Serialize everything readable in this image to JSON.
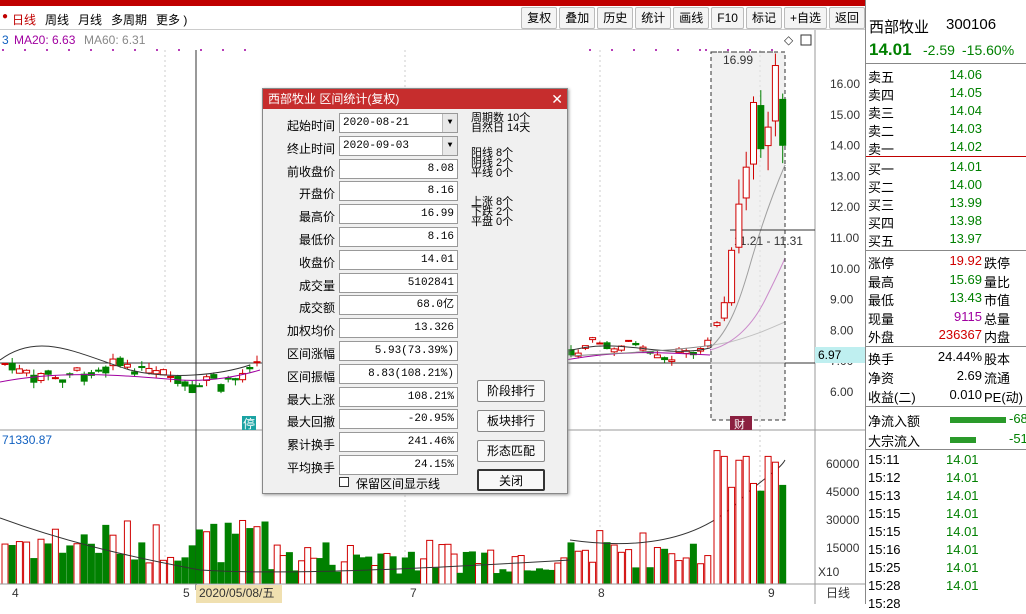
{
  "period_tabs": [
    "日线",
    "周线",
    "月线",
    "多周期",
    "更多 )"
  ],
  "toolbar": [
    "复权",
    "叠加",
    "历史",
    "统计",
    "画线",
    "F10",
    "标记",
    "+自选",
    "返回"
  ],
  "ma_legend": {
    "ma20": "MA20: 6.63",
    "ma60": "MA60: 6.31"
  },
  "price_axis": [
    "16.00",
    "15.00",
    "14.00",
    "13.00",
    "12.00",
    "11.00",
    "10.00",
    "9.00",
    "8.00",
    "7.00",
    "6.00"
  ],
  "vol_axis": [
    "60000",
    "45000",
    "30000",
    "15000",
    "X10"
  ],
  "date_axis": [
    "4",
    "5",
    "2020/05/08/五",
    "7",
    "8",
    "9",
    "日线"
  ],
  "price_marker": "6.97",
  "high_label": "16.99",
  "range_label": "11.21 - 11.31",
  "vol_label": "71330.87",
  "ting_mark": "停",
  "dialog": {
    "title": "西部牧业 区间统计(复权)",
    "fields": [
      {
        "label": "起始时间",
        "value": "2020-08-21",
        "type": "date"
      },
      {
        "label": "终止时间",
        "value": "2020-09-03",
        "type": "date"
      },
      {
        "label": "前收盘价",
        "value": "8.08"
      },
      {
        "label": "开盘价",
        "value": "8.16"
      },
      {
        "label": "最高价",
        "value": "16.99"
      },
      {
        "label": "最低价",
        "value": "8.16"
      },
      {
        "label": "收盘价",
        "value": "14.01"
      },
      {
        "label": "成交量",
        "value": "5102841"
      },
      {
        "label": "成交额",
        "value": "68.0亿"
      },
      {
        "label": "加权均价",
        "value": "13.326"
      },
      {
        "label": "区间涨幅",
        "value": "5.93(73.39%)"
      },
      {
        "label": "区间振幅",
        "value": "8.83(108.21%)"
      },
      {
        "label": "最大上涨",
        "value": "108.21%"
      },
      {
        "label": "最大回撤",
        "value": "-20.95%"
      },
      {
        "label": "累计换手",
        "value": "241.46%"
      },
      {
        "label": "平均换手",
        "value": "24.15%"
      }
    ],
    "stats": [
      "周期数 10个",
      "自然日 14天",
      "阳线 8个",
      "阴线 2个",
      "平线 0个",
      "上涨 8个",
      "下跌 2个",
      "平盘 0个"
    ],
    "buttons": [
      "阶段排行",
      "板块排行",
      "形态匹配",
      "关闭"
    ],
    "checkbox": "保留区间显示线"
  },
  "quote": {
    "name": "西部牧业",
    "code": "300106",
    "price": "14.01",
    "change": "-2.59",
    "pct": "-15.60%",
    "asks": [
      {
        "label": "卖五",
        "price": "14.06"
      },
      {
        "label": "卖四",
        "price": "14.05"
      },
      {
        "label": "卖三",
        "price": "14.04"
      },
      {
        "label": "卖二",
        "price": "14.03"
      },
      {
        "label": "卖一",
        "price": "14.02"
      }
    ],
    "bids": [
      {
        "label": "买一",
        "price": "14.01"
      },
      {
        "label": "买二",
        "price": "14.00"
      },
      {
        "label": "买三",
        "price": "13.99"
      },
      {
        "label": "买四",
        "price": "13.98"
      },
      {
        "label": "买五",
        "price": "13.97"
      }
    ],
    "stats": [
      {
        "l": "涨停",
        "v": "19.92",
        "r": "跌停"
      },
      {
        "l": "最高",
        "v": "15.69",
        "r": "量比"
      },
      {
        "l": "最低",
        "v": "13.43",
        "r": "市值"
      },
      {
        "l": "现量",
        "v": "9115",
        "r": "总量"
      },
      {
        "l": "外盘",
        "v": "236367",
        "r": "内盘"
      }
    ],
    "stats2": [
      {
        "l": "换手",
        "v": "24.44%",
        "r": "股本"
      },
      {
        "l": "净资",
        "v": "2.69",
        "r": "流通"
      },
      {
        "l": "收益(二)",
        "v": "0.010",
        "r": "PE(动)"
      }
    ],
    "flows": [
      {
        "l": "净流入额",
        "v": "-68"
      },
      {
        "l": "大宗流入",
        "v": "-51"
      }
    ],
    "ticks": [
      {
        "t": "15:11",
        "p": "14.01"
      },
      {
        "t": "15:12",
        "p": "14.01"
      },
      {
        "t": "15:13",
        "p": "14.01"
      },
      {
        "t": "15:15",
        "p": "14.01"
      },
      {
        "t": "15:15",
        "p": "14.01"
      },
      {
        "t": "15:16",
        "p": "14.01"
      },
      {
        "t": "15:25",
        "p": "14.01"
      },
      {
        "t": "15:28",
        "p": "14.01"
      },
      {
        "t": "15:28",
        "p": ""
      }
    ]
  },
  "chart_data": {
    "type": "candlestick",
    "ylim": [
      5.5,
      16.8
    ],
    "candles": [
      {
        "o": 8.16,
        "h": 8.3,
        "l": 8.1,
        "c": 8.25
      },
      {
        "o": 8.4,
        "h": 9.1,
        "l": 8.3,
        "c": 8.9
      },
      {
        "o": 8.9,
        "h": 10.7,
        "l": 8.8,
        "c": 10.6
      },
      {
        "o": 10.7,
        "h": 12.9,
        "l": 10.5,
        "c": 12.1
      },
      {
        "o": 12.3,
        "h": 13.8,
        "l": 11.9,
        "c": 13.3
      },
      {
        "o": 13.4,
        "h": 15.6,
        "l": 12.9,
        "c": 15.4
      },
      {
        "o": 15.3,
        "h": 15.8,
        "l": 13.6,
        "c": 13.9
      },
      {
        "o": 14.0,
        "h": 15.1,
        "l": 13.2,
        "c": 14.6
      },
      {
        "o": 14.8,
        "h": 16.99,
        "l": 14.3,
        "c": 16.6
      },
      {
        "o": 15.5,
        "h": 15.69,
        "l": 13.43,
        "c": 14.01
      }
    ],
    "volumes_x10": [
      69000,
      66000,
      50000,
      64000,
      66000,
      52000,
      48000,
      66000,
      63000,
      51000
    ]
  }
}
